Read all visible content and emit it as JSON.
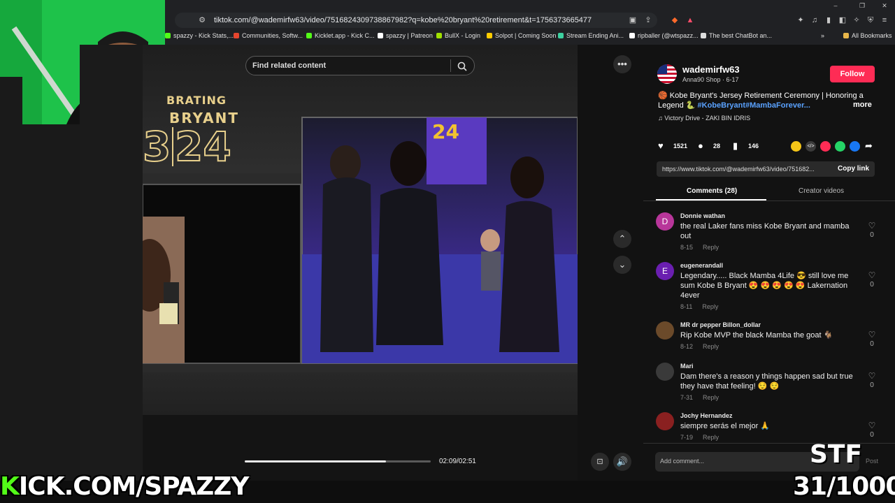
{
  "browser": {
    "url": "tiktok.com/@wademirfw63/video/7516824309738867982?q=kobe%20bryant%20retirement&t=1756373665477",
    "bookmarks": [
      "spazzy - Kick Stats,...",
      "Communities, Softw...",
      "Kicklet.app - Kick C...",
      "spazzy | Patreon",
      "BullX - Login",
      "Solpot | Coming Soon",
      "Stream Ending Ani...",
      "ripballer (@wtspazz...",
      "The best ChatBot an..."
    ],
    "all_bookmarks": "All Bookmarks"
  },
  "video": {
    "search_placeholder": "Find related content",
    "overlay_line1": "BRATING",
    "overlay_line2": "BRYANT",
    "overlay_number": "24",
    "overlay_prefix": "3",
    "jersey_number": "24",
    "time": "02:09/02:51",
    "progress": 0.76
  },
  "post": {
    "username": "wademirfw63",
    "subtitle": "Anna90 Shop · 6-17",
    "follow": "Follow",
    "caption_text": "🏀 Kobe Bryant's Jersey Retirement Ceremony | Honoring a Legend 🐍",
    "caption_tags": "#KobeBryant#MambaForever...",
    "more": "more",
    "music": "Victory Drive - ZAKI BIN IDRIS",
    "likes": "1521",
    "comments": "28",
    "saves": "146",
    "link": "https://www.tiktok.com/@wademirfw63/video/751682...",
    "copy_link": "Copy link",
    "tab_comments": "Comments (28)",
    "tab_creator": "Creator videos",
    "add_comment": "Add comment...",
    "post_btn": "Post"
  },
  "comments": [
    {
      "name": "Donnie wathan",
      "initial": "D",
      "color": "#b8369a",
      "text": "the real Laker fans miss Kobe Bryant and mamba out",
      "date": "8-15",
      "reply": "Reply",
      "likes": "0"
    },
    {
      "name": "eugenerandall",
      "initial": "E",
      "color": "#6a1fb0",
      "text": "Legendary..... Black Mamba 4Life 😎 still love me sum Kobe B Bryant 😍 😍 😍 😍 😍 Lakernation 4ever",
      "date": "8-11",
      "reply": "Reply",
      "likes": "0"
    },
    {
      "name": "MR dr pepper Billon_dollar",
      "initial": "",
      "color": "#6b4a2a",
      "text": "Rip Kobe MVP the black Mamba the goat 🐐",
      "date": "8-12",
      "reply": "Reply",
      "likes": "0"
    },
    {
      "name": "Mari",
      "initial": "",
      "color": "#3a3a3a",
      "text": "Dam there's a reason y things happen sad but true they have that feeling! 😌 😌",
      "date": "7-31",
      "reply": "Reply",
      "likes": "0"
    },
    {
      "name": "Jochy Hernandez",
      "initial": "",
      "color": "#8a2020",
      "text": "siempre serás el mejor 🙏",
      "date": "7-19",
      "reply": "Reply",
      "likes": "0"
    }
  ],
  "stream": {
    "brand": "KICK.COM/SPAZZY",
    "stf": "STF",
    "counter": "31/1000"
  },
  "colors": {
    "follow": "#fe2c55",
    "kick_green": "#53fc18",
    "tag": "#5aa2ff"
  }
}
